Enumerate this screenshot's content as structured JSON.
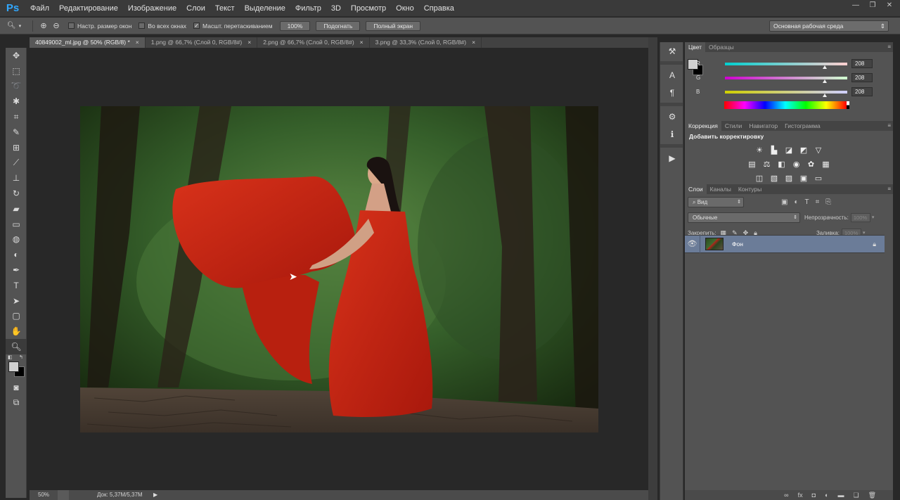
{
  "menubar": {
    "logo": "Ps",
    "items": [
      "Файл",
      "Редактирование",
      "Изображение",
      "Слои",
      "Текст",
      "Выделение",
      "Фильтр",
      "3D",
      "Просмотр",
      "Окно",
      "Справка"
    ]
  },
  "options": {
    "resize_windows": "Настр. размер окон",
    "all_windows": "Во всех окнах",
    "scrubby_zoom": "Масшт. перетаскиванием",
    "percent_btn": "100%",
    "fit_btn": "Подогнать",
    "fullscreen_btn": "Полный экран",
    "workspace": "Основная рабочая среда"
  },
  "tabs": [
    {
      "label": "40849002_ml.jpg @ 50% (RGB/8) *"
    },
    {
      "label": "1.png @ 66,7% (Слой 0, RGB/8#)"
    },
    {
      "label": "2.png @ 66,7% (Слой 0, RGB/8#)"
    },
    {
      "label": "3.png @ 33,3% (Слой 0, RGB/8#)"
    }
  ],
  "status": {
    "zoom": "50%",
    "doc": "Док: 5,37M/5,37M"
  },
  "color_panel": {
    "tabs": [
      "Цвет",
      "Образцы"
    ],
    "r_label": "R",
    "r_value": "208",
    "g_label": "G",
    "g_value": "208",
    "b_label": "B",
    "b_value": "208",
    "colors": {
      "fg": "#d0d0d0",
      "bg": "#000000"
    }
  },
  "adjust_panel": {
    "tabs": [
      "Коррекция",
      "Стили",
      "Навигатор",
      "Гистограмма"
    ],
    "title": "Добавить корректировку"
  },
  "layers_panel": {
    "tabs": [
      "Слои",
      "Каналы",
      "Контуры"
    ],
    "filter": "Вид",
    "blend_mode": "Обычные",
    "opacity_label": "Непрозрачность:",
    "opacity_value": "100%",
    "lock_label": "Закрепить:",
    "fill_label": "Заливка:",
    "fill_value": "100%",
    "layer_name": "Фон"
  }
}
